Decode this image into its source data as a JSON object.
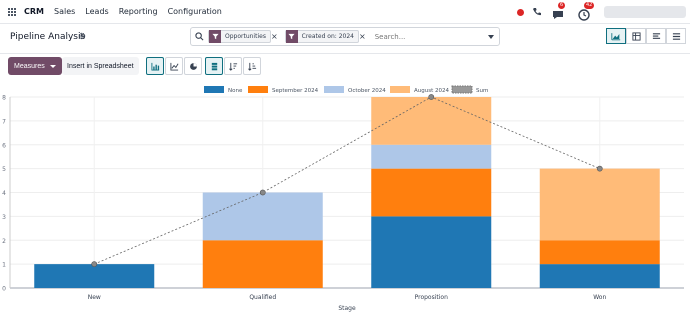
{
  "topbar": {
    "app_name": "CRM",
    "nav": [
      "Sales",
      "Leads",
      "Reporting",
      "Configuration"
    ],
    "chat_badge": "6",
    "activity_badge": "42"
  },
  "control": {
    "title": "Pipeline Analysis",
    "facets": [
      "Opportunities",
      "Created on: 2024"
    ],
    "search_placeholder": "Search..."
  },
  "toolbar": {
    "measures_label": "Measures",
    "spreadsheet_label": "Insert in Spreadsheet"
  },
  "colors": {
    "brand": "#714b67",
    "accent": "#0f6f7f",
    "none": "#1f77b4",
    "september": "#ff7f0e",
    "october": "#aec7e8",
    "august": "#ffbb78",
    "sum": "#999999"
  },
  "chart_data": {
    "type": "bar",
    "stacked": true,
    "xlabel": "Stage",
    "ylabel": "",
    "ylim": [
      0,
      8
    ],
    "grid": true,
    "legend_position": "top",
    "categories": [
      "New",
      "Qualified",
      "Proposition",
      "Won"
    ],
    "series": [
      {
        "name": "None",
        "color": "#1f77b4",
        "values": [
          1,
          0,
          3,
          1
        ]
      },
      {
        "name": "September 2024",
        "color": "#ff7f0e",
        "values": [
          0,
          2,
          2,
          1
        ]
      },
      {
        "name": "October 2024",
        "color": "#aec7e8",
        "values": [
          0,
          2,
          1,
          0
        ]
      },
      {
        "name": "August 2024",
        "color": "#ffbb78",
        "values": [
          0,
          0,
          2,
          3
        ]
      }
    ],
    "sum_line": {
      "name": "Sum",
      "values": [
        1,
        4,
        8,
        5
      ]
    },
    "yticks": [
      0,
      1,
      2,
      3,
      4,
      5,
      6,
      7,
      8
    ]
  }
}
